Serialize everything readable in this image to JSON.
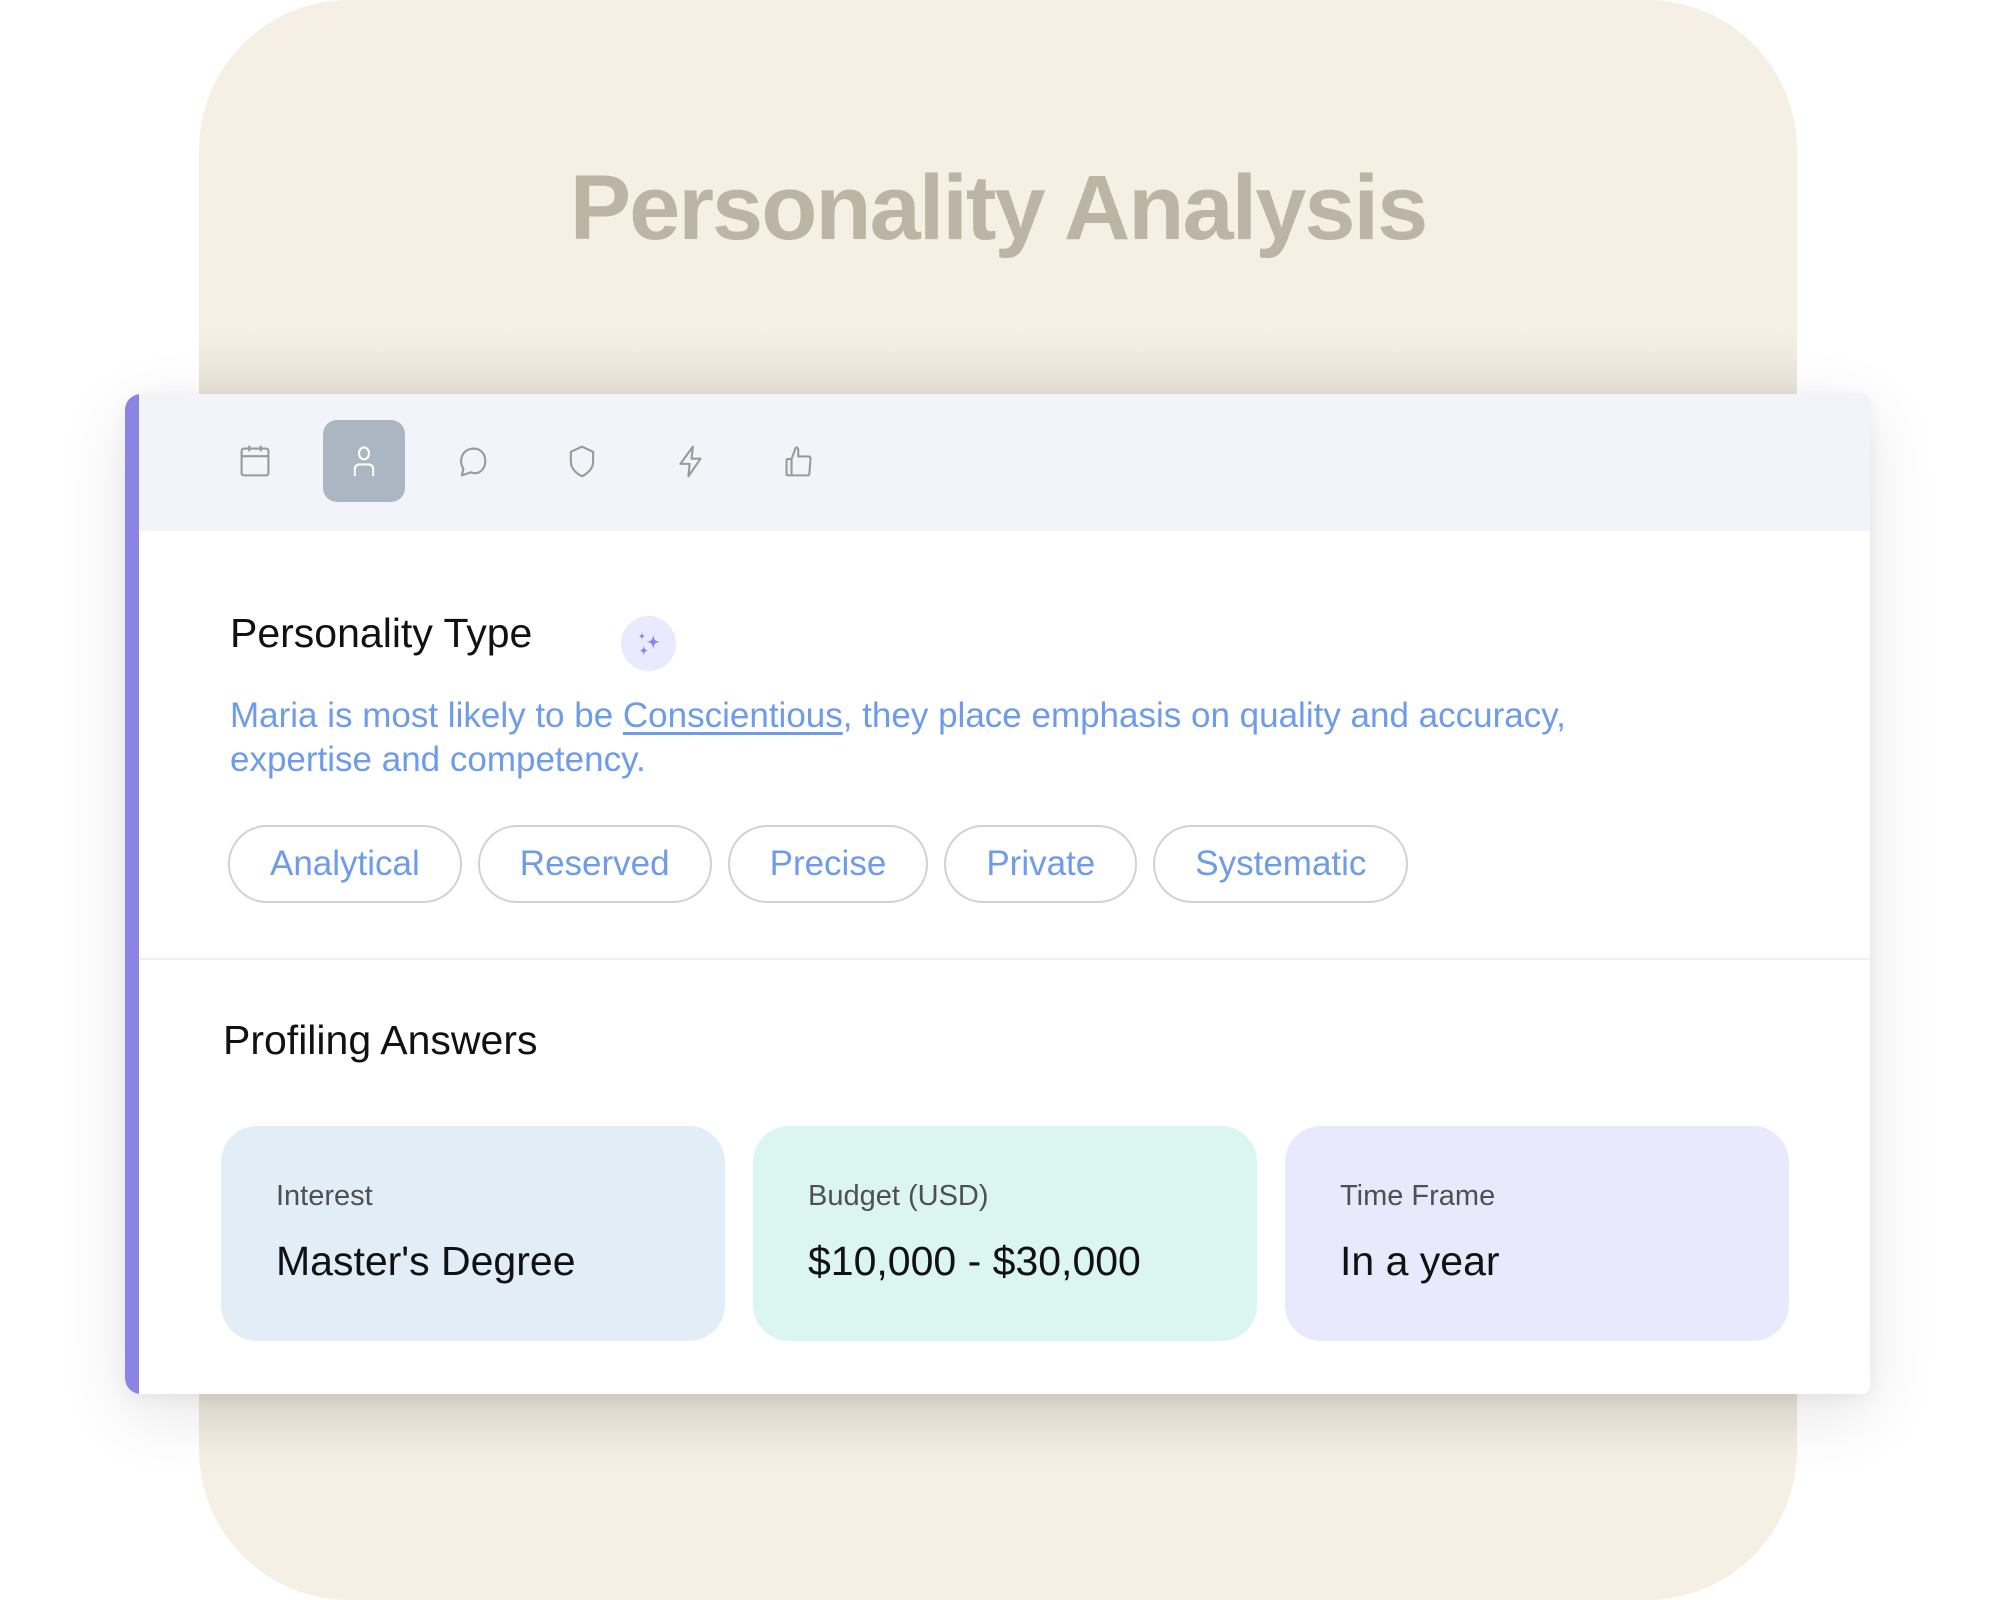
{
  "page": {
    "title": "Personality Analysis"
  },
  "tabs": [
    {
      "name": "calendar",
      "icon": "calendar-icon",
      "active": false
    },
    {
      "name": "profile",
      "icon": "person-icon",
      "active": true
    },
    {
      "name": "conversation",
      "icon": "chat-bubble-icon",
      "active": false
    },
    {
      "name": "security",
      "icon": "shield-icon",
      "active": false
    },
    {
      "name": "activity",
      "icon": "lightning-icon",
      "active": false
    },
    {
      "name": "feedback",
      "icon": "thumbs-up-icon",
      "active": false
    }
  ],
  "personality": {
    "heading": "Personality Type",
    "badge_icon": "sparkles-icon",
    "description_prefix": "Maria is most likely to be ",
    "description_link": "Conscientious",
    "description_suffix": ", they place emphasis on quality and accuracy, expertise and competency.",
    "traits": [
      "Analytical",
      "Reserved",
      "Precise",
      "Private",
      "Systematic"
    ]
  },
  "profiling": {
    "heading": "Profiling Answers",
    "answers": [
      {
        "label": "Interest",
        "value": "Master's Degree",
        "color": "#E1EEF8"
      },
      {
        "label": "Budget (USD)",
        "value": "$10,000 - $30,000",
        "color": "#DBF5F0"
      },
      {
        "label": "Time Frame",
        "value": "In a year",
        "color": "#E9E9FD"
      }
    ]
  },
  "colors": {
    "accent": "#8A85E2",
    "link_text": "#6E9BEA",
    "backdrop": "#F6F0E4",
    "title": "#BCB5A3",
    "active_tab": "#AAB6C2"
  }
}
